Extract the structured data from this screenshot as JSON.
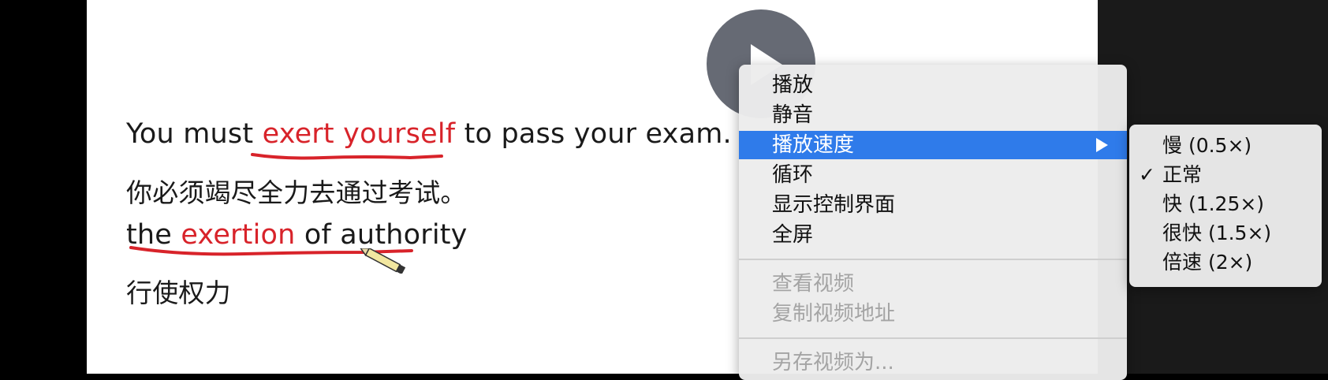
{
  "lesson": {
    "line1": {
      "before": "You must ",
      "highlight": "exert yourself",
      "after": " to pass your exam."
    },
    "line2": "你必须竭尽全力去通过考试。",
    "line3": {
      "before": "the ",
      "highlight": "exertion",
      "after": " of authority"
    },
    "line4": "行使权力"
  },
  "context_menu": {
    "items": [
      {
        "label": "播放"
      },
      {
        "label": "静音"
      },
      {
        "label": "播放速度",
        "highlighted": true,
        "has_submenu": true
      },
      {
        "label": "循环"
      },
      {
        "label": "显示控制界面"
      },
      {
        "label": "全屏"
      },
      {
        "label": "查看视频",
        "disabled": true
      },
      {
        "label": "复制视频地址",
        "disabled": true
      },
      {
        "label": "另存视频为...",
        "disabled": true
      }
    ]
  },
  "speed_submenu": {
    "checkmark": "✓",
    "items": [
      {
        "label": "慢 (0.5×)",
        "checked": false
      },
      {
        "label": "正常",
        "checked": true
      },
      {
        "label": "快 (1.25×)",
        "checked": false
      },
      {
        "label": "很快 (1.5×)",
        "checked": false
      },
      {
        "label": "倍速 (2×)",
        "checked": false
      }
    ]
  },
  "colors": {
    "highlight_text": "#d8232a",
    "menu_active": "#2f7bea",
    "menu_disabled_text": "#a4a4a4"
  }
}
